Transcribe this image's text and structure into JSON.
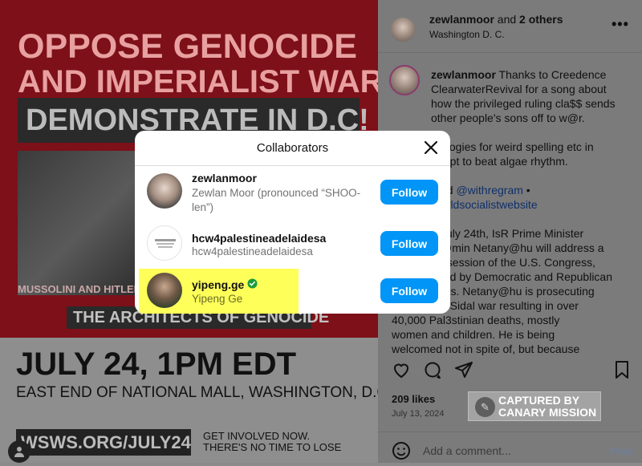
{
  "poster": {
    "headline1": "OPPOSE GENOCIDE",
    "headline2": "AND IMPERIALIST WAR!",
    "demonstrate": "DEMONSTRATE IN D.C!",
    "photo_caption": "MUSSOLINI AND HITLER",
    "architects": "THE ARCHITECTS OF GENOCIDE",
    "date": "JULY 24, 1PM EDT",
    "place": "EAST END OF NATIONAL MALL, WASHINGTON, D.C.",
    "url": "WSWS.ORG/JULY24",
    "involved_line1": "GET INVOLVED NOW.",
    "involved_line2": "THERE'S NO TIME TO LOSE"
  },
  "post_header": {
    "author": "zewlanmoor",
    "joiner": " and ",
    "others": "2 others",
    "location": "Washington D. C.",
    "more_icon": "more-options-icon"
  },
  "caption": {
    "author": "zewlanmoor",
    "p1": "Thanks to Creedence ClearwaterRevival for a song about how the privileged ruling cla$$ sends other people's sons off to w@r.",
    "p2_partial": "...ologies for weird spelling etc in ...mpt to beat algae rhythm.",
    "p2a": "ologies for weird spelling etc in",
    "p2b": "mpt to beat algae rhythm.",
    "p3a": "ed ",
    "link1": "@withregram",
    "bullet": " •",
    "link2": "orldsocialistwebsite",
    "p4": [
      "July 24th, IsR Prime Minister",
      "@min Netany@hu will address a",
      "t session of the U.S. Congress,",
      "ted by Democratic and Republican",
      "ers. Netany@hu is prosecuting",
      "0 Sidal war resulting in over",
      "40,000 Pal3stinian deaths, mostly",
      "women and children. He is being",
      "welcomed not in spite of, but because"
    ]
  },
  "actions": {
    "icons": [
      "heart-icon",
      "comment-icon",
      "share-icon",
      "bookmark-icon"
    ],
    "likes": "209 likes",
    "date": "July 13, 2024"
  },
  "watermark": {
    "line1": "CAPTURED BY",
    "line2": "CANARY MISSION"
  },
  "comment": {
    "placeholder": "Add a comment...",
    "post_label": "Post"
  },
  "modal": {
    "title": "Collaborators",
    "close_icon": "close-icon",
    "rows": [
      {
        "handle": "zewlanmoor",
        "name": "Zewlan Moor (pronounced “SHOO-len”)",
        "button": "Follow",
        "verified": false
      },
      {
        "handle": "hcw4palestineadelaidesa",
        "name": "hcw4palestineadelaidesa",
        "button": "Follow",
        "verified": false
      },
      {
        "handle": "yipeng.ge",
        "name": "Yipeng Ge",
        "button": "Follow",
        "verified": true
      }
    ]
  },
  "colors": {
    "follow_button": "#0095f6",
    "highlight": "#ffff59",
    "verified": "#1a9c3a"
  }
}
